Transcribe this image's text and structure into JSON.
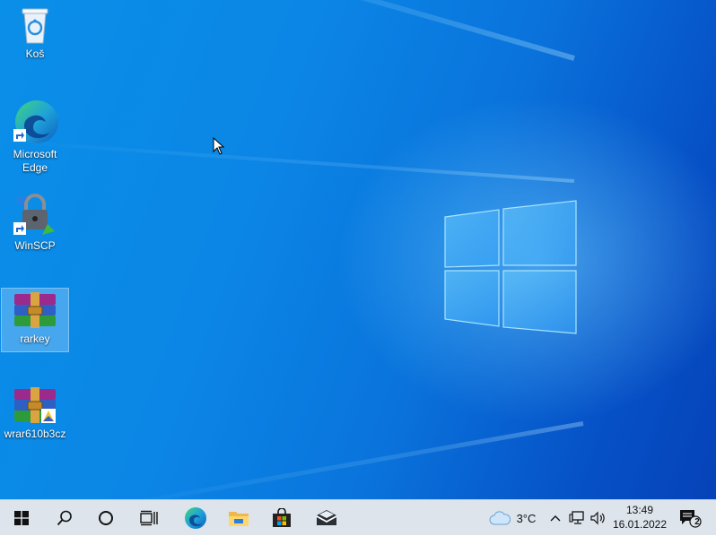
{
  "desktop": {
    "icons": [
      {
        "label": "Koš",
        "icon": "recycle-bin-icon"
      },
      {
        "label": "Microsoft Edge",
        "icon": "edge-icon"
      },
      {
        "label": "WinSCP",
        "icon": "winscp-icon"
      },
      {
        "label": "rarkey",
        "icon": "winrar-icon",
        "selected": true
      },
      {
        "label": "wrar610b3cz",
        "icon": "winrar-installer-icon"
      }
    ]
  },
  "taskbar": {
    "start": "windows-start-icon",
    "search": "search-icon",
    "cortana": "cortana-icon",
    "task_view": "task-view-icon",
    "pinned": [
      "edge-icon",
      "file-explorer-icon",
      "store-icon",
      "mail-icon"
    ],
    "weather": {
      "temperature": "3°C",
      "icon": "cloud-icon"
    },
    "tray": [
      "chevron-up-icon",
      "network-icon",
      "volume-icon"
    ],
    "clock": {
      "time": "13:49",
      "date": "16.01.2022"
    },
    "notifications": {
      "count": "2",
      "icon": "notification-icon"
    }
  }
}
